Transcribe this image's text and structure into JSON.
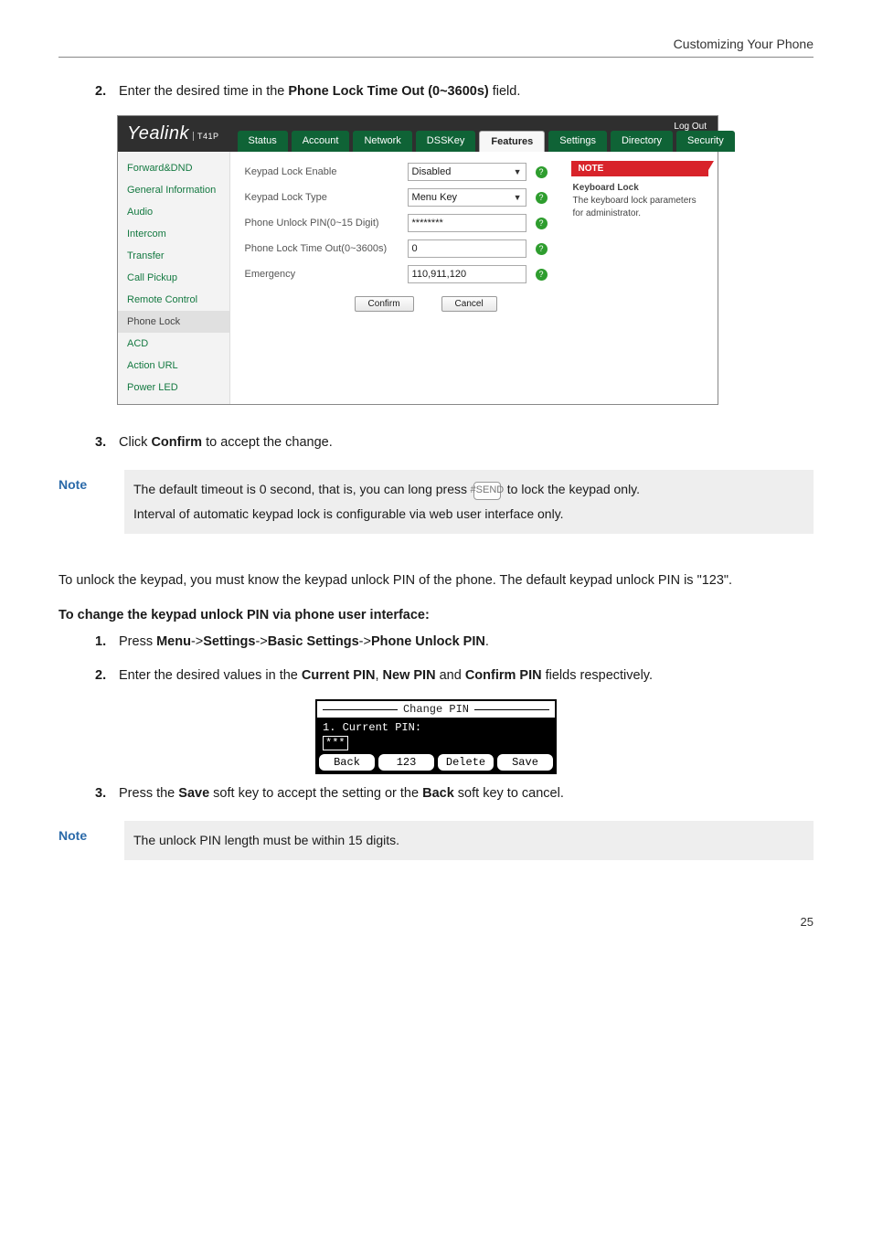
{
  "header": {
    "title": "Customizing Your Phone"
  },
  "step2": {
    "num": "2.",
    "pre": "Enter the desired time in the ",
    "bold": "Phone Lock Time Out (0~3600s)",
    "post": " field."
  },
  "webui": {
    "logo": "Yealink",
    "logo_sub": "T41P",
    "logout": "Log Out",
    "tabs": [
      "Status",
      "Account",
      "Network",
      "DSSKey",
      "Features",
      "Settings",
      "Directory",
      "Security"
    ],
    "active_tab": "Features",
    "side": [
      "Forward&DND",
      "General Information",
      "Audio",
      "Intercom",
      "Transfer",
      "Call Pickup",
      "Remote Control",
      "Phone Lock",
      "ACD",
      "Action URL",
      "Power LED"
    ],
    "side_selected": "Phone Lock",
    "rows": [
      {
        "label": "Keypad Lock Enable",
        "value": "Disabled",
        "type": "select"
      },
      {
        "label": "Keypad Lock Type",
        "value": "Menu Key",
        "type": "select"
      },
      {
        "label": "Phone Unlock PIN(0~15 Digit)",
        "value": "********",
        "type": "text"
      },
      {
        "label": "Phone Lock Time Out(0~3600s)",
        "value": "0",
        "type": "text"
      },
      {
        "label": "Emergency",
        "value": "110,911,120",
        "type": "text"
      }
    ],
    "confirm": "Confirm",
    "cancel": "Cancel",
    "note_title": "NOTE",
    "note_body1": "Keyboard Lock",
    "note_body2": "The keyboard lock parameters for administrator."
  },
  "step3": {
    "num": "3.",
    "pre": "Click ",
    "bold": "Confirm",
    "post": " to accept the change."
  },
  "note1": {
    "label": "Note",
    "line1_pre": "The default timeout is 0 second, that is, you can long press ",
    "key": "#SEND",
    "line1_post": " to lock the keypad only.",
    "line2": "Interval of automatic keypad lock is configurable via web user interface only."
  },
  "para1": "To unlock the keypad, you must know the keypad unlock PIN of the phone. The default keypad unlock PIN is \"123\".",
  "heading": "To change the keypad unlock PIN via phone user interface:",
  "s1": {
    "num": "1.",
    "parts": [
      "Press ",
      "Menu",
      "->",
      "Settings",
      "->",
      "Basic Settings",
      "->",
      "Phone Unlock PIN",
      "."
    ]
  },
  "s2b": {
    "num": "2.",
    "parts": [
      "Enter the desired values in the ",
      "Current PIN",
      ", ",
      "New PIN",
      " and ",
      "Confirm PIN",
      " fields respectively."
    ]
  },
  "lcd": {
    "title": "Change PIN",
    "row_label": "1. Current PIN:",
    "row_value": "***",
    "soft": [
      "Back",
      "123",
      "Delete",
      "Save"
    ]
  },
  "s3b": {
    "num": "3.",
    "parts": [
      "Press the ",
      "Save",
      " soft key to accept the setting or the ",
      "Back",
      " soft key to cancel."
    ]
  },
  "note2": {
    "label": "Note",
    "text": "The unlock PIN length must be within 15 digits."
  },
  "pagenum": "25"
}
